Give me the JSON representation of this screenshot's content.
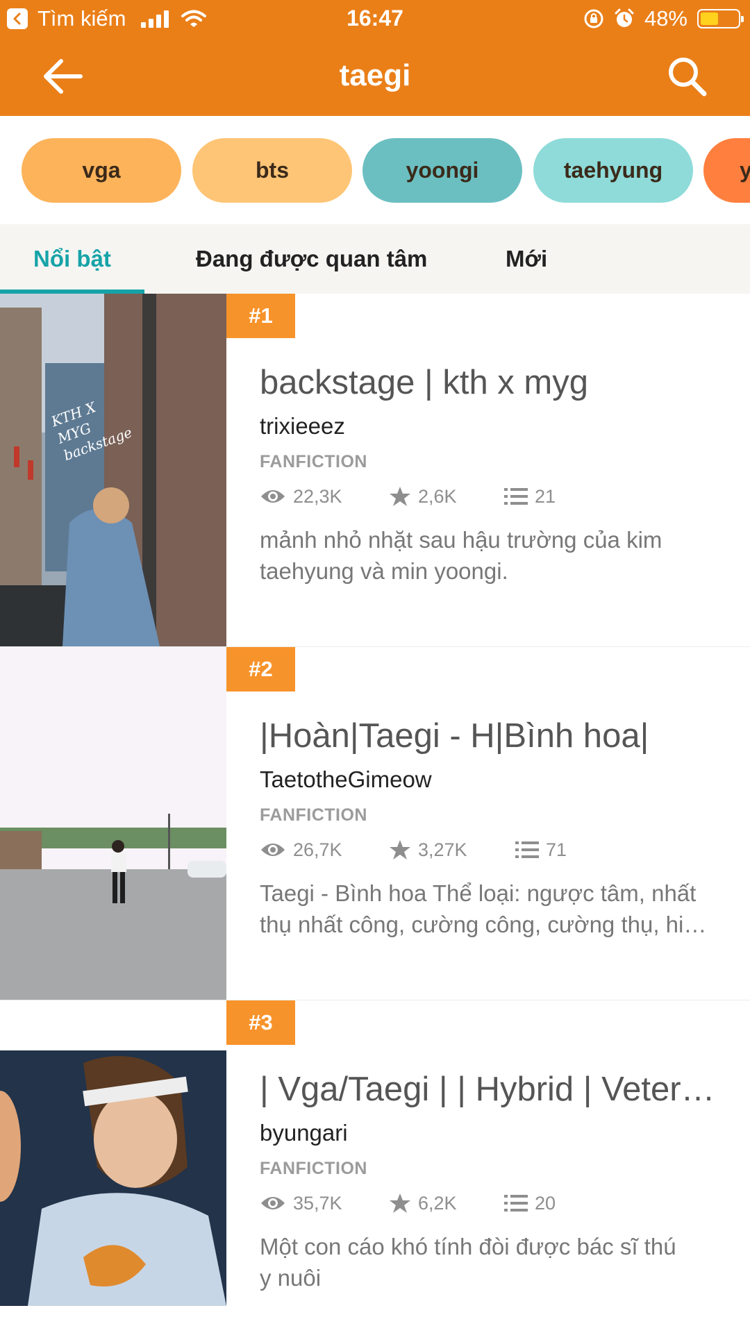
{
  "status_bar": {
    "back_app_label": "Tìm kiếm",
    "time": "16:47",
    "battery_percent": "48%",
    "battery_level": 0.48,
    "accent": "#EA7F18"
  },
  "header": {
    "title": "taegi",
    "back_icon": "arrow-left-icon",
    "search_icon": "search-icon"
  },
  "tags": [
    {
      "label": "vga",
      "color": "#FDB35A"
    },
    {
      "label": "bts",
      "color": "#FEC576"
    },
    {
      "label": "yoongi",
      "color": "#6BBFC1"
    },
    {
      "label": "taehyung",
      "color": "#8EDBD9"
    },
    {
      "label": "y",
      "color": "#FF7F3F"
    }
  ],
  "tabs": [
    {
      "label": "Nổi bật",
      "active": true
    },
    {
      "label": "Đang được quan tâm",
      "active": false
    },
    {
      "label": "Mới",
      "active": false
    }
  ],
  "stories": [
    {
      "rank": "#1",
      "title": "backstage | kth x myg",
      "author": "trixieeez",
      "category": "FANFICTION",
      "views": "22,3K",
      "votes": "2,6K",
      "parts": "21",
      "description": [
        "mảnh nhỏ nhặt sau hậu trường của kim",
        "taehyung và min yoongi."
      ],
      "cover_overlay_text": "KTH X MYG backstage"
    },
    {
      "rank": "#2",
      "title": "|Hoàn|Taegi - H|Bình hoa|",
      "author": "TaetotheGimeow",
      "category": "FANFICTION",
      "views": "26,7K",
      "votes": "3,27K",
      "parts": "71",
      "description": [
        "Taegi - Bình hoa  Thể loại: ngược tâm, nhất",
        "thụ nhất công, cường công, cường thụ, hi…"
      ]
    },
    {
      "rank": "#3",
      "title": "| Vga/Taegi | | Hybrid | Veteri…",
      "author": "byungari",
      "category": "FANFICTION",
      "views": "35,7K",
      "votes": "6,2K",
      "parts": "20",
      "description": [
        "Một con cáo khó tính đòi được bác sĩ thú",
        "y nuôi"
      ]
    }
  ]
}
